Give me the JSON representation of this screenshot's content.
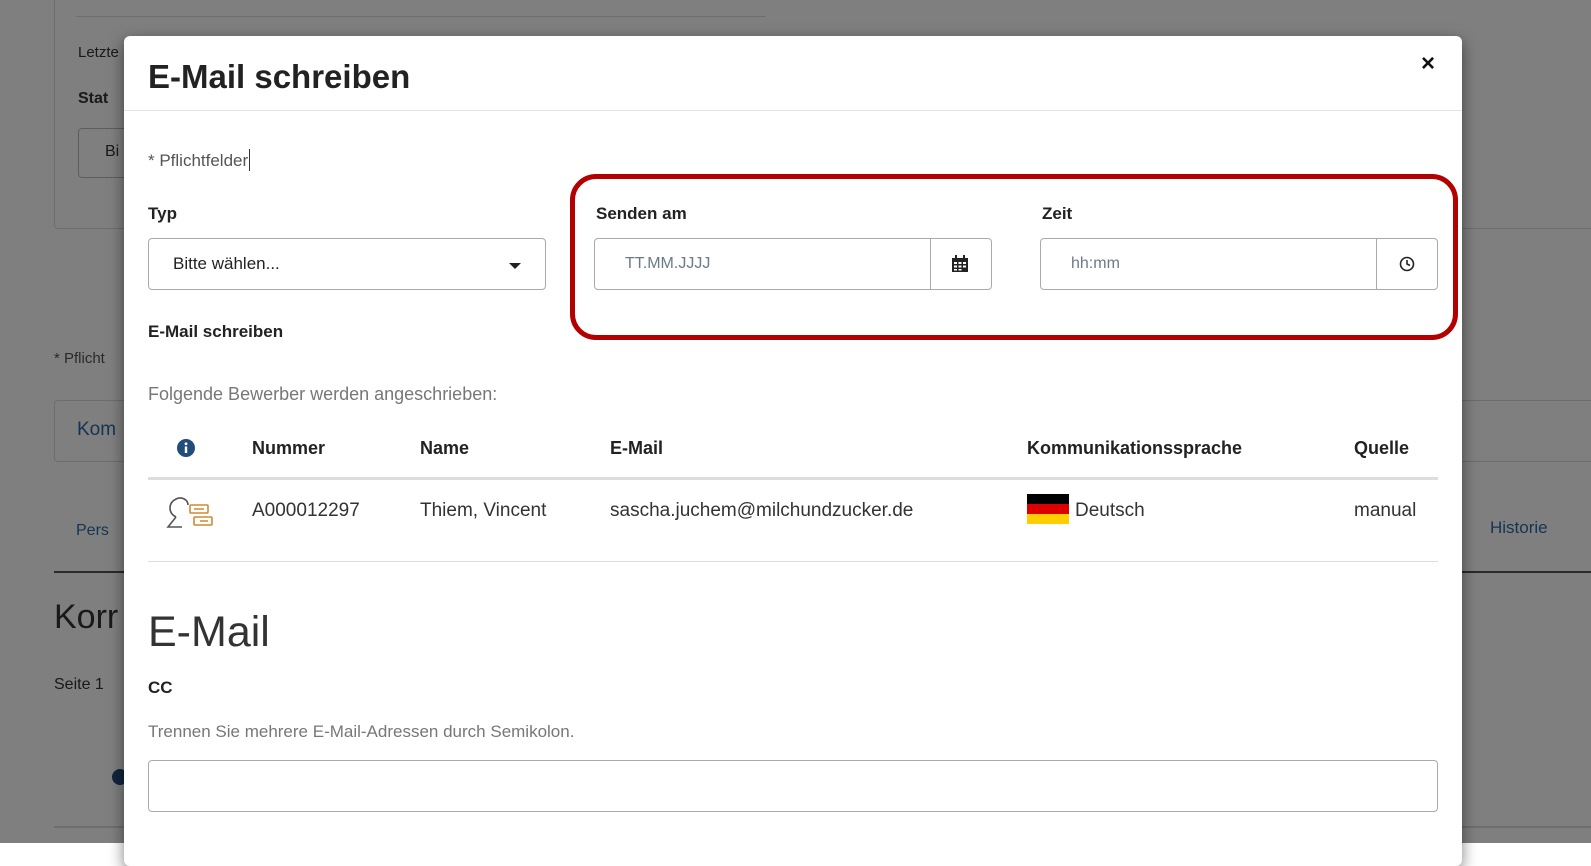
{
  "background": {
    "letzte_label": "Letzte",
    "status_label": "Stat",
    "button_text": "Bi",
    "required_hint": "* Pflicht",
    "box_text": "Kom",
    "tab_text": "Pers",
    "tab_historie": "Historie",
    "section_heading": "Korr",
    "page_text": "Seite 1"
  },
  "modal": {
    "title": "E-Mail schreiben",
    "close_symbol": "×",
    "required_note": "* Pflichtfelder",
    "typ": {
      "label": "Typ",
      "selected": "Bitte wählen..."
    },
    "send_date": {
      "label": "Senden am",
      "placeholder": "TT.MM.JJJJ",
      "icon": "calendar-icon"
    },
    "send_time": {
      "label": "Zeit",
      "placeholder": "hh:mm",
      "icon": "clock-icon"
    },
    "compose_label": "E-Mail schreiben",
    "recipients_hint": "Folgende Bewerber werden angeschrieben:",
    "table": {
      "headers": [
        "Nummer",
        "Name",
        "E-Mail",
        "Kommunikationssprache",
        "Quelle"
      ],
      "info_icon": "info-icon",
      "rows": [
        {
          "icon": "workflow-icon",
          "nummer": "A000012297",
          "name": "Thiem, Vincent",
          "email": "sascha.juchem@milchundzucker.de",
          "sprache": "Deutsch",
          "quelle": "manual"
        }
      ]
    },
    "email_section": {
      "title": "E-Mail",
      "cc_label": "CC",
      "cc_hint": "Trennen Sie mehrere E-Mail-Adressen durch Semikolon.",
      "cc_value": ""
    }
  },
  "colors": {
    "highlight": "#b30000",
    "icon_orange": "#d08a2e",
    "info_icon": "#234c7a"
  }
}
